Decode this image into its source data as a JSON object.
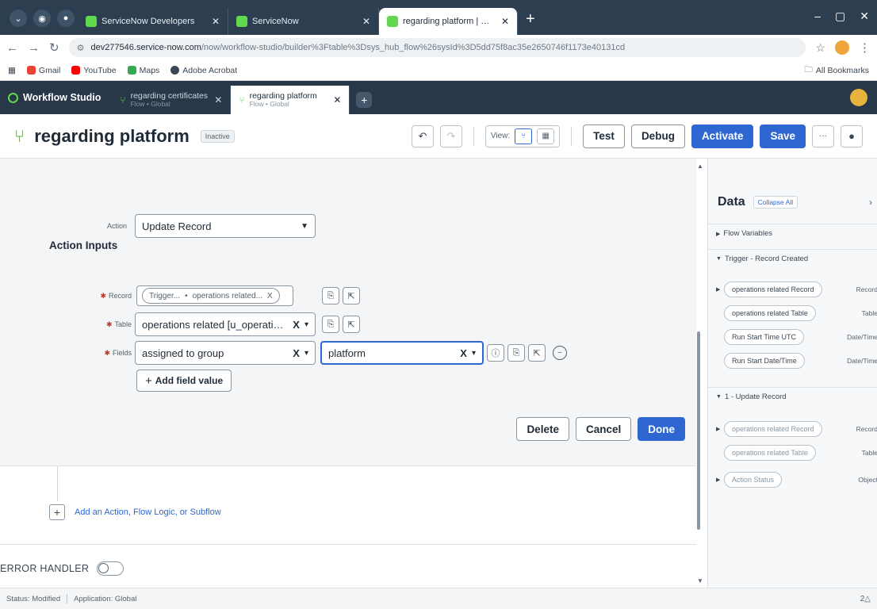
{
  "browser": {
    "tabs": [
      {
        "label": "ServiceNow Developers",
        "active": false
      },
      {
        "label": "ServiceNow",
        "active": false
      },
      {
        "label": "regarding platform | Workflow",
        "active": true
      }
    ],
    "new_tab": "+",
    "url_host": "dev277546.service-now.com",
    "url_path": "/now/workflow-studio/builder%3Ftable%3Dsys_hub_flow%26sysId%3D5dd75f8ac35e2650746f1173e40131cd",
    "bookmarks": [
      "Gmail",
      "YouTube",
      "Maps",
      "Adobe Acrobat"
    ],
    "all_bookmarks": "All Bookmarks"
  },
  "studio": {
    "brand": "Workflow Studio",
    "tabs": [
      {
        "title": "regarding certificates",
        "subtitle": "Flow • Global",
        "active": false
      },
      {
        "title": "regarding platform",
        "subtitle": "Flow • Global",
        "active": true
      }
    ],
    "add_tab": "+"
  },
  "header": {
    "title": "regarding platform",
    "status_badge": "Inactive",
    "view_label": "View:",
    "buttons": {
      "test": "Test",
      "debug": "Debug",
      "activate": "Activate",
      "save": "Save",
      "more": "···"
    }
  },
  "editor": {
    "action_label": "Action",
    "action_value": "Update Record",
    "section_title": "Action Inputs",
    "record": {
      "label": "Record",
      "pill_parent": "Trigger...",
      "pill_child": "operations related...",
      "remove": "X"
    },
    "table": {
      "label": "Table",
      "value": "operations related [u_operations..."
    },
    "fields": {
      "label": "Fields",
      "field_value": "assigned to group",
      "input_value": "platform"
    },
    "add_field_value": "Add field value",
    "buttons": {
      "delete": "Delete",
      "cancel": "Cancel",
      "done": "Done"
    }
  },
  "canvas": {
    "add_action": "Add an Action, Flow Logic, or Subflow",
    "error_handler": "ERROR HANDLER"
  },
  "data_pane": {
    "title": "Data",
    "collapse_all": "Collapse All",
    "sections": [
      {
        "title": "Flow Variables",
        "expanded": false
      },
      {
        "title": "Trigger - Record Created",
        "expanded": true
      },
      {
        "title": "1 - Update Record",
        "expanded": true
      }
    ],
    "trigger_items": [
      {
        "label": "operations related Record",
        "type": "Record",
        "expandable": true
      },
      {
        "label": "operations related Table",
        "type": "Table",
        "expandable": false
      },
      {
        "label": "Run Start Time UTC",
        "type": "Date/Time",
        "expandable": false
      },
      {
        "label": "Run Start Date/Time",
        "type": "Date/Time",
        "expandable": false
      }
    ],
    "update_items": [
      {
        "label": "operations related Record",
        "type": "Record",
        "expandable": true
      },
      {
        "label": "operations related Table",
        "type": "Table",
        "expandable": false
      },
      {
        "label": "Action Status",
        "type": "Object",
        "expandable": true
      }
    ]
  },
  "status_bar": {
    "status": "Status: Modified",
    "application": "Application: Global",
    "right": "2△"
  },
  "colors": {
    "primary": "#2e67d1",
    "studio_bar": "#283848",
    "brand_green": "#62d84e"
  }
}
